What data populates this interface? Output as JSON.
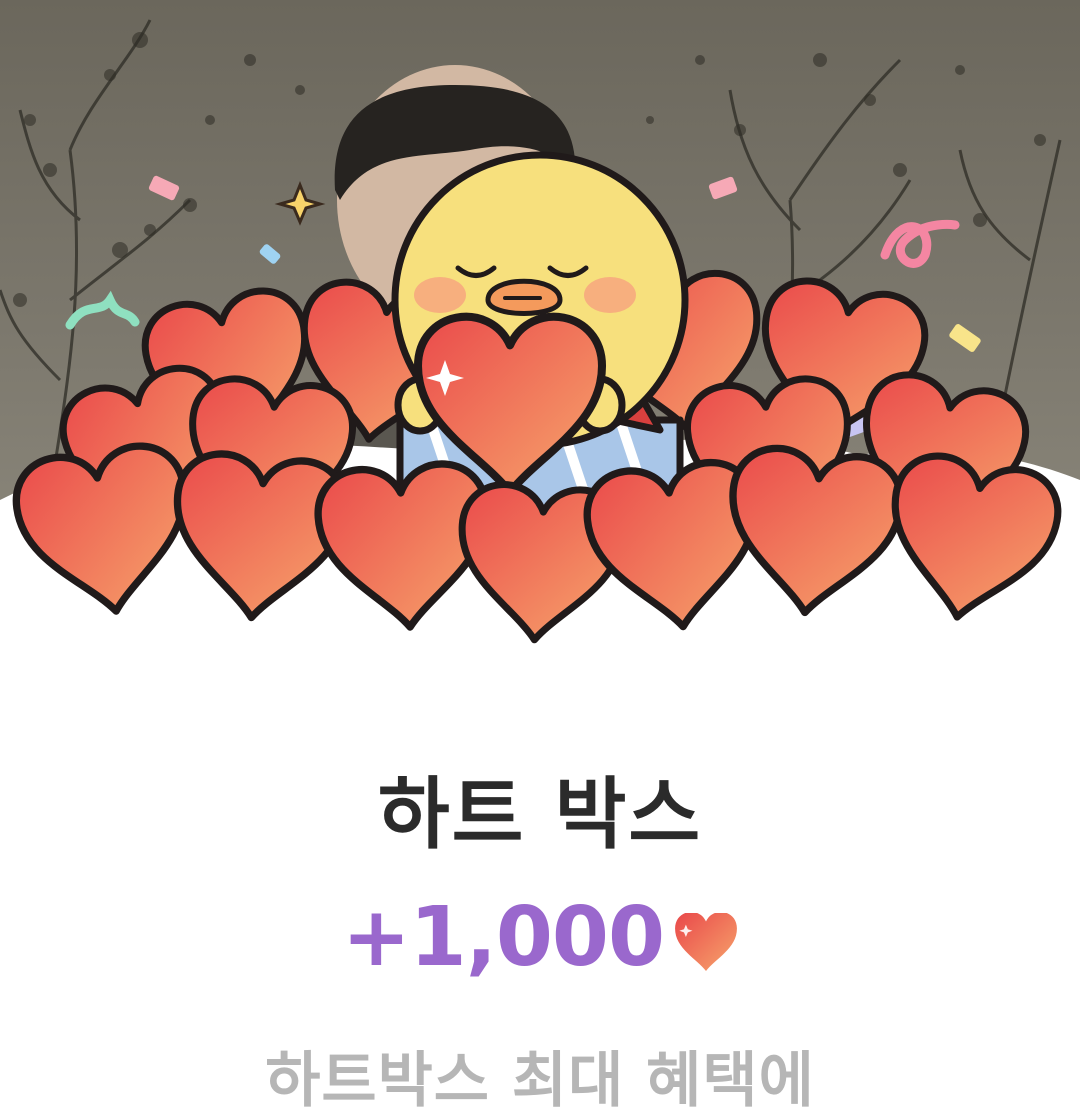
{
  "reward": {
    "title": "하트 박스",
    "amount": "+1,000",
    "subtitle": "하트박스 최대 혜택에"
  },
  "icons": {
    "amount_icon": "heart-icon",
    "mascot": "yellow-chick-character",
    "gift": "gift-box-icon"
  },
  "colors": {
    "title": "#2b2b2b",
    "amount": "#9a68cd",
    "subtitle": "#b6b6b6",
    "heart_light": "#f7a26a",
    "heart_dark": "#e9474a"
  }
}
